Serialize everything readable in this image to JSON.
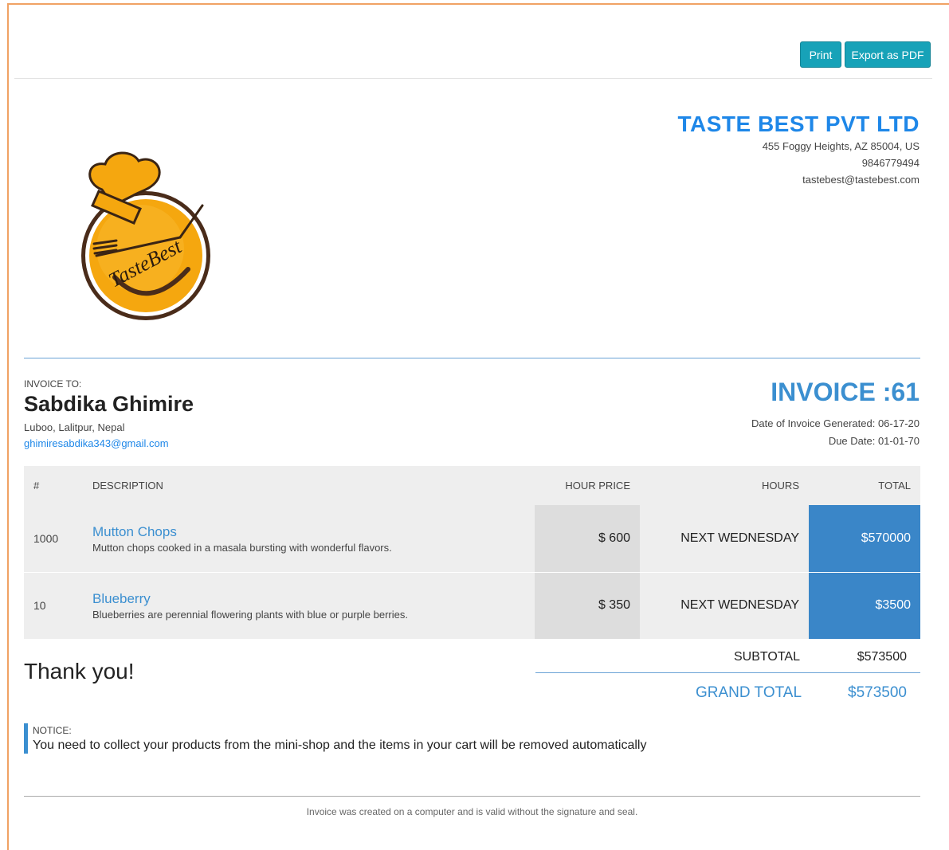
{
  "toolbar": {
    "print_label": "Print",
    "export_label": "Export as PDF",
    "accent_color": "#17a2b8"
  },
  "company": {
    "name": "TASTE BEST PVT LTD",
    "address": "455 Foggy Heights, AZ 85004, US",
    "phone": "9846779494",
    "email": "tastebest@tastebest.com",
    "logo_text": "TasteBest",
    "brand_color": "#1e87e8"
  },
  "client": {
    "label": "INVOICE TO:",
    "name": "Sabdika Ghimire",
    "address": "Luboo, Lalitpur, Nepal",
    "email": "ghimiresabdika343@gmail.com"
  },
  "invoice": {
    "title": "INVOICE :61",
    "generated": "Date of Invoice Generated: 06-17-20",
    "due": "Due Date: 01-01-70"
  },
  "table": {
    "headers": [
      "#",
      "DESCRIPTION",
      "HOUR PRICE",
      "HOURS",
      "TOTAL"
    ],
    "rows": [
      {
        "no": "1000",
        "name": "Mutton Chops",
        "description": "Mutton chops cooked in a masala bursting with wonderful flavors.",
        "price": "$ 600",
        "hours": "NEXT WEDNESDAY",
        "total": "$570000"
      },
      {
        "no": "10",
        "name": "Blueberry",
        "description": "Blueberries are perennial flowering plants with blue or purple berries.",
        "price": "$ 350",
        "hours": "NEXT WEDNESDAY",
        "total": "$3500"
      }
    ]
  },
  "thanks": "Thank you!",
  "summary": {
    "subtotal_label": "SUBTOTAL",
    "subtotal_value": "$573500",
    "grand_label": "GRAND TOTAL",
    "grand_value": "$573500"
  },
  "notice": {
    "label": "NOTICE:",
    "text": "You need to collect your products from the mini-shop and the items in your cart will be removed automatically"
  },
  "footer": {
    "text": "Invoice was created on a computer and is valid without the signature and seal."
  }
}
